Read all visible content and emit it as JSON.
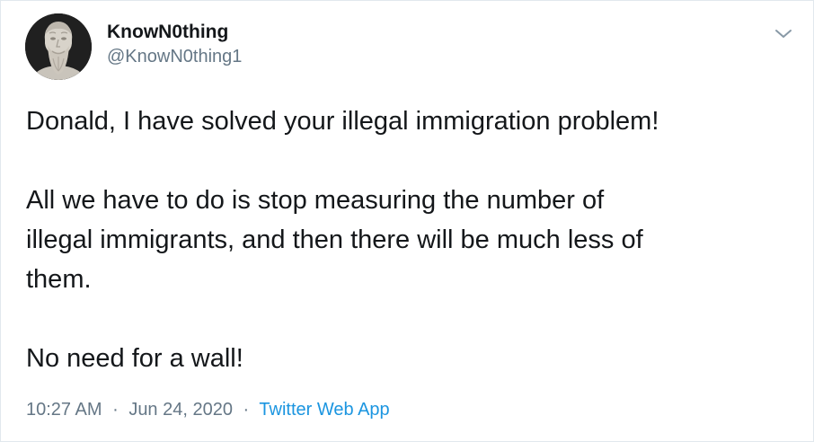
{
  "user": {
    "display_name": "KnowN0thing",
    "handle": "@KnowN0thing1",
    "avatar_icon": "bust-statue-avatar"
  },
  "tweet": {
    "text": "Donald, I have solved your illegal immigration problem!\n\nAll we have to do is stop measuring the number of\nillegal immigrants, and then there will be much less of\nthem.\n\nNo need for a wall!",
    "time": "10:27 AM",
    "separator": "·",
    "date": "Jun 24, 2020",
    "source": "Twitter Web App"
  },
  "menu": {
    "icon": "chevron-down-icon"
  },
  "colors": {
    "text": "#14171a",
    "secondary": "#657786",
    "link": "#1b95e0",
    "border": "#e1e8ed"
  }
}
